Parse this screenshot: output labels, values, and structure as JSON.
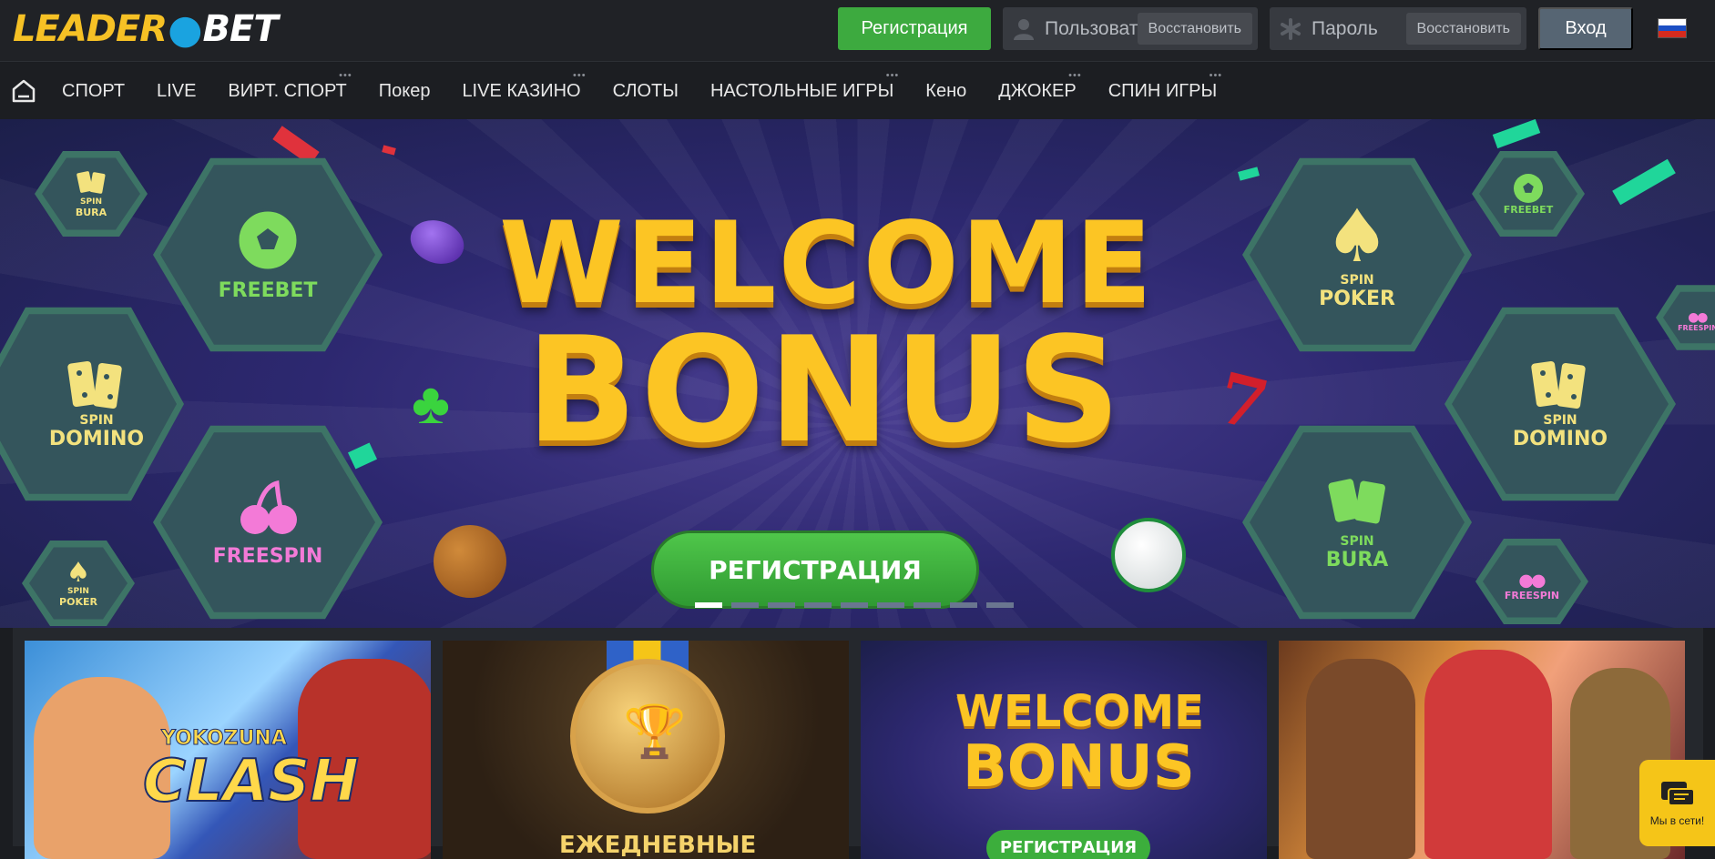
{
  "header": {
    "logo_part1": "LEADER",
    "logo_dot": "●",
    "logo_part2": "BET",
    "register_label": "Регистрация",
    "username_placeholder": "Пользователь",
    "username_restore": "Восстановить",
    "password_placeholder": "Пароль",
    "password_restore": "Восстановить",
    "login_label": "Вход",
    "language": "ru"
  },
  "nav": {
    "items": [
      {
        "label": "СПОРТ",
        "more": false
      },
      {
        "label": "LIVE",
        "more": false
      },
      {
        "label": "ВИРТ. СПОРТ",
        "more": true
      },
      {
        "label": "Покер",
        "more": false
      },
      {
        "label": "LIVE КАЗИНО",
        "more": true
      },
      {
        "label": "СЛОТЫ",
        "more": false
      },
      {
        "label": "НАСТОЛЬНЫЕ ИГРЫ",
        "more": true
      },
      {
        "label": "Кено",
        "more": false
      },
      {
        "label": "ДЖОКЕР",
        "more": true
      },
      {
        "label": "СПИН ИГРЫ",
        "more": true
      }
    ],
    "more_marker": "•••"
  },
  "banner": {
    "headline_1": "WELCOME",
    "headline_2": "BONUS",
    "cta_label": "РЕГИСТРАЦИЯ",
    "slides_total": 9,
    "active_slide": 1,
    "left_hexes": {
      "spin_bura_small": "SPIN",
      "spin_bura_big": "BURA",
      "freebet": "FREEBET",
      "spin_domino_small": "SPIN",
      "spin_domino_big": "DOMINO",
      "freespin": "FREESPIN",
      "spin_poker_small": "SPIN",
      "spin_poker_big": "POKER"
    },
    "right_hexes": {
      "spin_poker_small": "SPIN",
      "spin_poker_big": "POKER",
      "freebet": "FREEBET",
      "freespin_small": "FREESPIN",
      "spin_domino_small": "SPIN",
      "spin_domino_big": "DOMINO",
      "spin_bura_small": "SPIN",
      "spin_bura_big": "BURA",
      "freespin": "FREESPIN"
    }
  },
  "cards": [
    {
      "title_1": "YOKOZUNA",
      "title_2": "CLASH"
    },
    {
      "title_1": "ЕЖЕДНЕВНЫЕ"
    },
    {
      "title_1": "WELCOME",
      "title_2": "BONUS",
      "cta": "РЕГИСТРАЦИЯ"
    },
    {
      "title_1": ""
    }
  ],
  "chat": {
    "label": "Мы в сети!"
  },
  "colors": {
    "brand_yellow": "#f6c125",
    "brand_blue": "#1aa3e0",
    "register_green": "#3daa3f",
    "login_gray": "#566573"
  }
}
